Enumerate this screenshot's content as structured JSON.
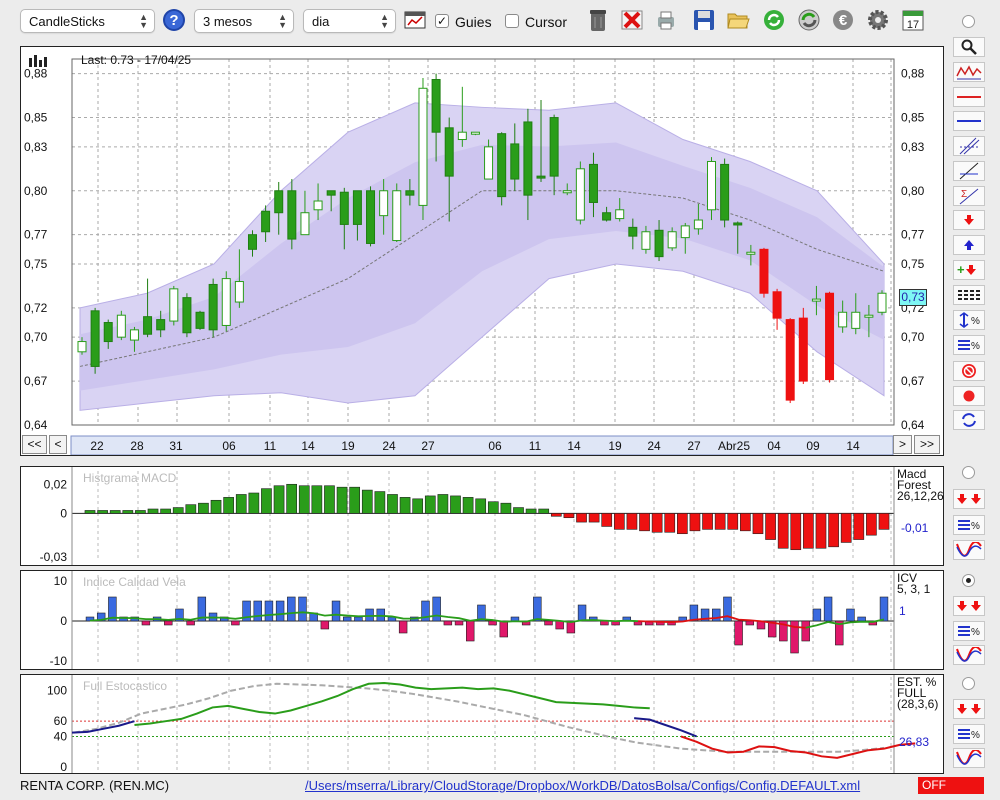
{
  "toolbar": {
    "chart_type": "CandleSticks",
    "period": "3 mesos",
    "interval": "dia",
    "guides_label": "Guies",
    "guides_checked": true,
    "cursor_label": "Cursor",
    "cursor_checked": false,
    "calendar_day": "17"
  },
  "price_panel": {
    "last_label": "Last: 0.73 - 17/04/25",
    "current_value": "0,73",
    "y_ticks": [
      "0,88",
      "0,85",
      "0,83",
      "0,80",
      "0,77",
      "0,75",
      "0,72",
      "0,70",
      "0,67",
      "0,64"
    ],
    "x_ticks": [
      "22",
      "28",
      "31",
      "06",
      "11",
      "14",
      "19",
      "24",
      "27",
      "06",
      "11",
      "14",
      "19",
      "24",
      "27",
      "Abr25",
      "04",
      "09",
      "14"
    ],
    "nav": {
      "first": "<<",
      "prev": "<",
      "next": ">",
      "last": ">>"
    }
  },
  "macd_panel": {
    "title": "Histgrama MACD",
    "y_ticks": [
      "0,02",
      "0",
      "-0,03"
    ],
    "legend_name": "Macd Forest",
    "legend_params": "26,12,26",
    "value": "-0,01"
  },
  "icv_panel": {
    "title": "Indice Calidad Vela",
    "y_ticks": [
      "10",
      "0",
      "-10"
    ],
    "legend_name": "ICV",
    "legend_params": "5, 3, 1",
    "value": "1"
  },
  "stoch_panel": {
    "title": "Full Estocastico",
    "y_ticks": [
      "100",
      "60",
      "40",
      "0"
    ],
    "legend_name": "EST. % FULL",
    "legend_params": "(28,3,6)",
    "value": "26,83"
  },
  "status": {
    "company": "RENTA CORP. (REN.MC)",
    "path": "/Users/mserra/Library/CloudStorage/Dropbox/WorkDB/DatosBolsa/Configs/Config.DEFAULT.xml",
    "toggle": "OFF"
  },
  "chart_data": [
    {
      "type": "candlestick",
      "ylim": [
        0.64,
        0.89
      ],
      "candles": [
        [
          0.69,
          0.697,
          0.688,
          0.7
        ],
        [
          0.718,
          0.68,
          0.675,
          0.72
        ],
        [
          0.71,
          0.697,
          0.692,
          0.712
        ],
        [
          0.7,
          0.715,
          0.698,
          0.718
        ],
        [
          0.698,
          0.705,
          0.69,
          0.707
        ],
        [
          0.714,
          0.702,
          0.7,
          0.74
        ],
        [
          0.712,
          0.705,
          0.7,
          0.718
        ],
        [
          0.711,
          0.733,
          0.708,
          0.735
        ],
        [
          0.727,
          0.703,
          0.7,
          0.73
        ],
        [
          0.717,
          0.706,
          0.705,
          0.718
        ],
        [
          0.736,
          0.705,
          0.7,
          0.74
        ],
        [
          0.708,
          0.74,
          0.704,
          0.745
        ],
        [
          0.724,
          0.738,
          0.72,
          0.76
        ],
        [
          0.77,
          0.76,
          0.755,
          0.773
        ],
        [
          0.786,
          0.772,
          0.765,
          0.79
        ],
        [
          0.8,
          0.785,
          0.77,
          0.806
        ],
        [
          0.8,
          0.767,
          0.76,
          0.808
        ],
        [
          0.77,
          0.785,
          0.77,
          0.8
        ],
        [
          0.787,
          0.793,
          0.78,
          0.805
        ],
        [
          0.8,
          0.797,
          0.786,
          0.8
        ],
        [
          0.799,
          0.777,
          0.76,
          0.802
        ],
        [
          0.8,
          0.777,
          0.766,
          0.8
        ],
        [
          0.8,
          0.764,
          0.762,
          0.803
        ],
        [
          0.783,
          0.8,
          0.77,
          0.808
        ],
        [
          0.766,
          0.8,
          0.765,
          0.805
        ],
        [
          0.8,
          0.797,
          0.79,
          0.808
        ],
        [
          0.79,
          0.87,
          0.78,
          0.877
        ],
        [
          0.876,
          0.84,
          0.82,
          0.88
        ],
        [
          0.843,
          0.81,
          0.779,
          0.85
        ],
        [
          0.835,
          0.84,
          0.83,
          0.871
        ],
        [
          0.84,
          0.84,
          0.838,
          0.84
        ],
        [
          0.808,
          0.83,
          0.81,
          0.835
        ],
        [
          0.839,
          0.796,
          0.79,
          0.84
        ],
        [
          0.832,
          0.808,
          0.8,
          0.846
        ],
        [
          0.847,
          0.797,
          0.78,
          0.856
        ],
        [
          0.81,
          0.809,
          0.806,
          0.862
        ],
        [
          0.85,
          0.81,
          0.797,
          0.852
        ],
        [
          0.8,
          0.8,
          0.797,
          0.805
        ],
        [
          0.78,
          0.815,
          0.777,
          0.82
        ],
        [
          0.818,
          0.792,
          0.782,
          0.826
        ],
        [
          0.785,
          0.78,
          0.779,
          0.789
        ],
        [
          0.781,
          0.787,
          0.779,
          0.795
        ],
        [
          0.775,
          0.769,
          0.76,
          0.781
        ],
        [
          0.76,
          0.772,
          0.757,
          0.776
        ],
        [
          0.773,
          0.755,
          0.752,
          0.78
        ],
        [
          0.761,
          0.772,
          0.759,
          0.775
        ],
        [
          0.768,
          0.776,
          0.757,
          0.778
        ],
        [
          0.774,
          0.78,
          0.77,
          0.791
        ],
        [
          0.787,
          0.82,
          0.78,
          0.823
        ],
        [
          0.818,
          0.78,
          0.775,
          0.822
        ],
        [
          0.778,
          0.777,
          0.757,
          0.779
        ],
        [
          0.758,
          0.758,
          0.749,
          0.763
        ],
        [
          0.76,
          0.73,
          0.727,
          0.761
        ],
        [
          0.731,
          0.713,
          0.705,
          0.733
        ],
        [
          0.712,
          0.657,
          0.655,
          0.713
        ],
        [
          0.713,
          0.67,
          0.668,
          0.72
        ],
        [
          0.726,
          0.726,
          0.715,
          0.735
        ],
        [
          0.73,
          0.671,
          0.669,
          0.731
        ],
        [
          0.707,
          0.717,
          0.703,
          0.725
        ],
        [
          0.706,
          0.717,
          0.702,
          0.73
        ],
        [
          0.714,
          0.715,
          0.7,
          0.722
        ],
        [
          0.717,
          0.73,
          0.715,
          0.732
        ]
      ],
      "bollinger": {
        "upper": [
          0.72,
          0.73,
          0.75,
          0.8,
          0.84,
          0.86,
          0.857,
          0.855,
          0.86,
          0.835,
          0.82,
          0.8,
          0.75
        ],
        "middle": [
          0.68,
          0.69,
          0.7,
          0.72,
          0.74,
          0.77,
          0.8,
          0.8,
          0.8,
          0.795,
          0.78,
          0.76,
          0.745
        ],
        "lower": [
          0.65,
          0.655,
          0.66,
          0.662,
          0.655,
          0.66,
          0.7,
          0.74,
          0.75,
          0.745,
          0.73,
          0.69,
          0.66
        ]
      }
    },
    {
      "type": "bar",
      "ylim": [
        -0.03,
        0.025
      ],
      "values": [
        0.002,
        0.002,
        0.002,
        0.002,
        0.002,
        0.003,
        0.003,
        0.004,
        0.006,
        0.007,
        0.009,
        0.011,
        0.013,
        0.014,
        0.017,
        0.019,
        0.02,
        0.019,
        0.019,
        0.019,
        0.018,
        0.018,
        0.016,
        0.015,
        0.013,
        0.011,
        0.01,
        0.012,
        0.013,
        0.012,
        0.011,
        0.01,
        0.008,
        0.007,
        0.004,
        0.003,
        0.003,
        -0.002,
        -0.003,
        -0.006,
        -0.006,
        -0.009,
        -0.011,
        -0.011,
        -0.012,
        -0.013,
        -0.013,
        -0.014,
        -0.012,
        -0.011,
        -0.011,
        -0.011,
        -0.012,
        -0.014,
        -0.018,
        -0.024,
        -0.025,
        -0.024,
        -0.024,
        -0.023,
        -0.02,
        -0.018,
        -0.015,
        -0.011
      ]
    },
    {
      "type": "bar",
      "ylim": [
        -10,
        10
      ],
      "values": [
        1,
        2,
        6,
        1,
        1,
        -1,
        1,
        -1,
        3,
        -1,
        6,
        2,
        1,
        -1,
        5,
        5,
        5,
        5,
        6,
        6,
        2,
        -2,
        5,
        1,
        1,
        3,
        3,
        1,
        -3,
        1,
        5,
        6,
        -1,
        -1,
        -5,
        4,
        -1,
        -4,
        1,
        -1,
        6,
        -1,
        -2,
        -3,
        4,
        1,
        -1,
        -1,
        1,
        -1,
        -1,
        -1,
        -1,
        1,
        4,
        3,
        3,
        6,
        -6,
        -1,
        -2,
        -4,
        -5,
        -8,
        -5,
        3,
        6,
        -6,
        3,
        1,
        -1,
        6
      ]
    },
    {
      "type": "line",
      "ylim": [
        0,
        110
      ],
      "series": [
        {
          "color": "#2a9d1a",
          "values": [
            55,
            57,
            60,
            63,
            70,
            78,
            80,
            76,
            72,
            70,
            74,
            80,
            86,
            93,
            102,
            109,
            110,
            108,
            104,
            102,
            103,
            104,
            102,
            103,
            100,
            95,
            90,
            85,
            84,
            83,
            82,
            80,
            78,
            77
          ]
        },
        {
          "color": "#1a1a8a",
          "values": [
            45,
            46,
            50,
            54,
            60
          ]
        },
        {
          "color": "#1a1a8a",
          "values": [
            64,
            62,
            55,
            48,
            40
          ]
        },
        {
          "color": "#dd1111",
          "values": [
            40,
            33,
            24,
            19,
            20,
            27,
            26,
            21,
            19,
            14,
            12,
            17,
            22,
            24,
            29,
            31
          ]
        },
        {
          "color": "#aaaaaa",
          "values": [
            45,
            50,
            58,
            70,
            76,
            82,
            90,
            100,
            106,
            109,
            108,
            107,
            105,
            103,
            100,
            96,
            91,
            86,
            80,
            74,
            68,
            60,
            52,
            45,
            38,
            32,
            28,
            24,
            22,
            20,
            20,
            20,
            20,
            20,
            20,
            22,
            25
          ]
        }
      ]
    }
  ]
}
